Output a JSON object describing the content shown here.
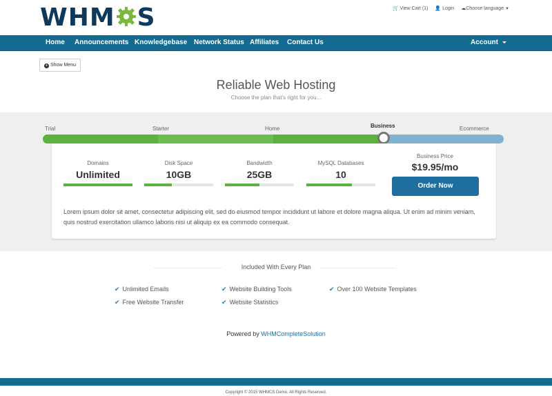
{
  "header": {
    "logo_left": "WHM",
    "logo_right": "S",
    "cart": "Cart (1)",
    "login": "Login",
    "language": "Choose language",
    "cart_prefix": "View"
  },
  "nav": {
    "items": [
      "Home",
      "Announcements",
      "Knowledgebase",
      "Network Status",
      "Affiliates",
      "Contact Us"
    ],
    "account": "Account"
  },
  "show_menu": "Show Menu",
  "page": {
    "title": "Reliable Web Hosting",
    "subtitle": "Choose the plan that's right for you..."
  },
  "plans": {
    "labels": [
      "Trial",
      "Starter",
      "Home",
      "Business",
      "Ecommerce"
    ],
    "selected": "Business",
    "slider_position": 0.74
  },
  "plan_details": {
    "stats": [
      {
        "label": "Domains",
        "value": "Unlimited",
        "fill": 1.0
      },
      {
        "label": "Disk Space",
        "value": "10GB",
        "fill": 0.4
      },
      {
        "label": "Bandwidth",
        "value": "25GB",
        "fill": 0.5
      },
      {
        "label": "MySQL Databases",
        "value": "10",
        "fill": 0.66
      }
    ],
    "price_label": "Business Price",
    "price": "$19.95/mo",
    "order_button": "Order Now",
    "description": "Lorem ipsum dolor sit amet, consectetur adipiscing elit, sed do eiusmod tempor incididunt ut labore et dolore magna aliqua. Ut enim ad minim veniam, quis nostrud exercitation ullamco laboris nisi ut aliquip ex ea commodo consequat."
  },
  "included": {
    "title": "Included With Every Plan",
    "features": [
      "Unlimited Emails",
      "Website Building Tools",
      "Over 100 Website Templates",
      "Free Website Transfer",
      "Website Statistics"
    ]
  },
  "powered": {
    "prefix": "Powered by",
    "link": "WHMCompleteSolution"
  },
  "footer": {
    "copyright": "Copyright © 2015 WHMCS Demo. All Rights Reserved."
  },
  "colors": {
    "brand_blue": "#146a91",
    "green": "#5cb23f",
    "button_blue": "#1e6f9f"
  }
}
